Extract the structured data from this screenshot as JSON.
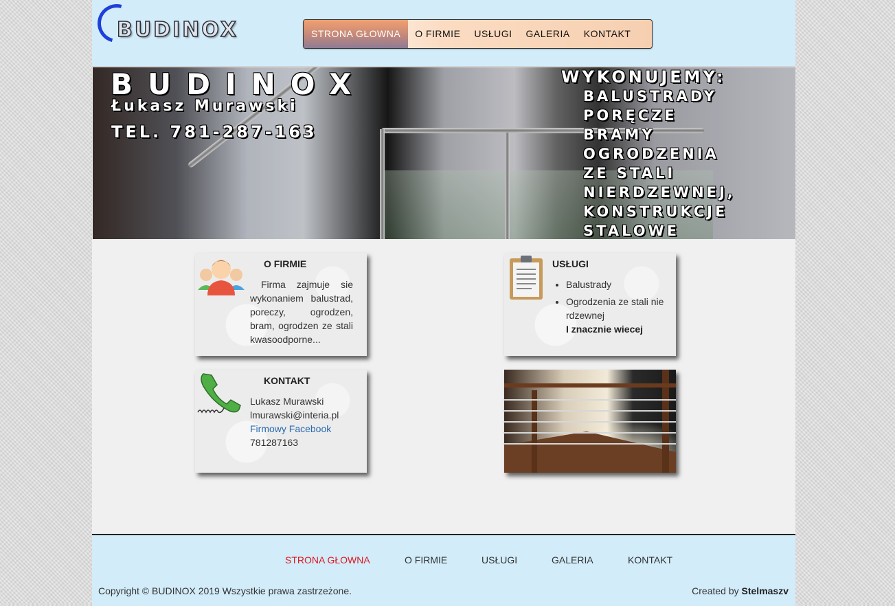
{
  "header": {
    "logo_text": "BUDINOX",
    "nav": [
      {
        "label": "STRONA GŁOWNA",
        "active": true
      },
      {
        "label": "O FIRMIE"
      },
      {
        "label": "USŁUGI"
      },
      {
        "label": "GALERIA"
      },
      {
        "label": "KONTAKT"
      }
    ]
  },
  "banner": {
    "title": "BUDINOX",
    "name": "Łukasz Murawski",
    "phone": "TEL. 781-287-163",
    "services_heading": "WYKONUJEMY:",
    "services": [
      "BALUSTRADY",
      "PORĘCZE",
      "BRAMY",
      "OGRODZENIA",
      "ZE STALI",
      "NIERDZEWNEJ,",
      "KONSTRUKCJE",
      "STALOWE"
    ]
  },
  "cards": {
    "about": {
      "title": "O FIRMIE",
      "text": "Firma zajmuje sie wykonaniem balustrad, poreczy, ogrodzen, bram, ogrodzen ze stali kwasoodporne...",
      "icon": "people-icon"
    },
    "services": {
      "title": "USŁUGI",
      "items": [
        "Balustrady",
        "Ogrodzenia ze stali nie rdzewnej"
      ],
      "more": "I znacznie wiecej",
      "icon": "clipboard-icon"
    },
    "contact": {
      "title": "KONTAKT",
      "name": "Lukasz Murawski",
      "email": "lmurawski@interia.pl",
      "facebook": "Firmowy Facebook",
      "phone": "781287163",
      "icon": "phone-icon"
    }
  },
  "footer": {
    "nav": [
      {
        "label": "STRONA GŁOWNA",
        "active": true
      },
      {
        "label": "O FIRMIE"
      },
      {
        "label": "USŁUGI"
      },
      {
        "label": "GALERIA"
      },
      {
        "label": "KONTAKT"
      }
    ],
    "copyright": "Copyright © BUDINOX 2019 Wszystkie prawa zastrzeżone.",
    "credit_prefix": "Created by",
    "credit_name": "Stelmaszv"
  },
  "colors": {
    "header_bg": "#d2ecfa",
    "footer_active": "#e0161f",
    "link": "#2a6ab0"
  }
}
